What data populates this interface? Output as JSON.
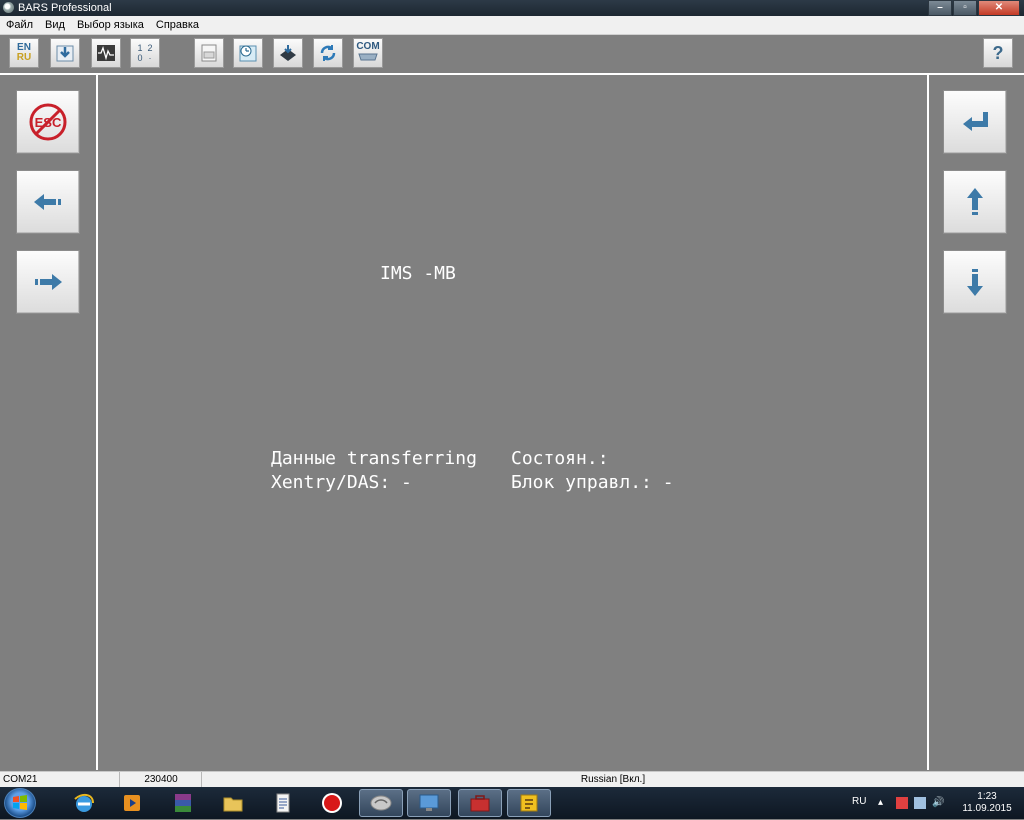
{
  "window": {
    "title": "BARS Professional"
  },
  "menu": [
    "Файл",
    "Вид",
    "Выбор языка",
    "Справка"
  ],
  "toolbar": {
    "lang_en": "EN",
    "lang_ru": "RU",
    "nums": [
      "1",
      "2",
      "0",
      "·"
    ],
    "com_label": "COM",
    "help_label": "?"
  },
  "left_nav": {
    "esc_label": "ESC"
  },
  "display": {
    "header": "IMS -MB",
    "row1_left": "Данные transferring",
    "row1_right": "Состоян.:",
    "row2_left": "Xentry/DAS: -",
    "row2_right": "Блок управл.: -"
  },
  "statusbar": {
    "port": "COM21",
    "baud": "230400",
    "language": "Russian [Вкл.]"
  },
  "taskbar": {
    "lang": "RU",
    "time": "1:23",
    "date": "11.09.2015"
  },
  "colors": {
    "accent_blue": "#3d7aa8",
    "esc_red": "#c8202a",
    "panel_gray": "#808080"
  }
}
